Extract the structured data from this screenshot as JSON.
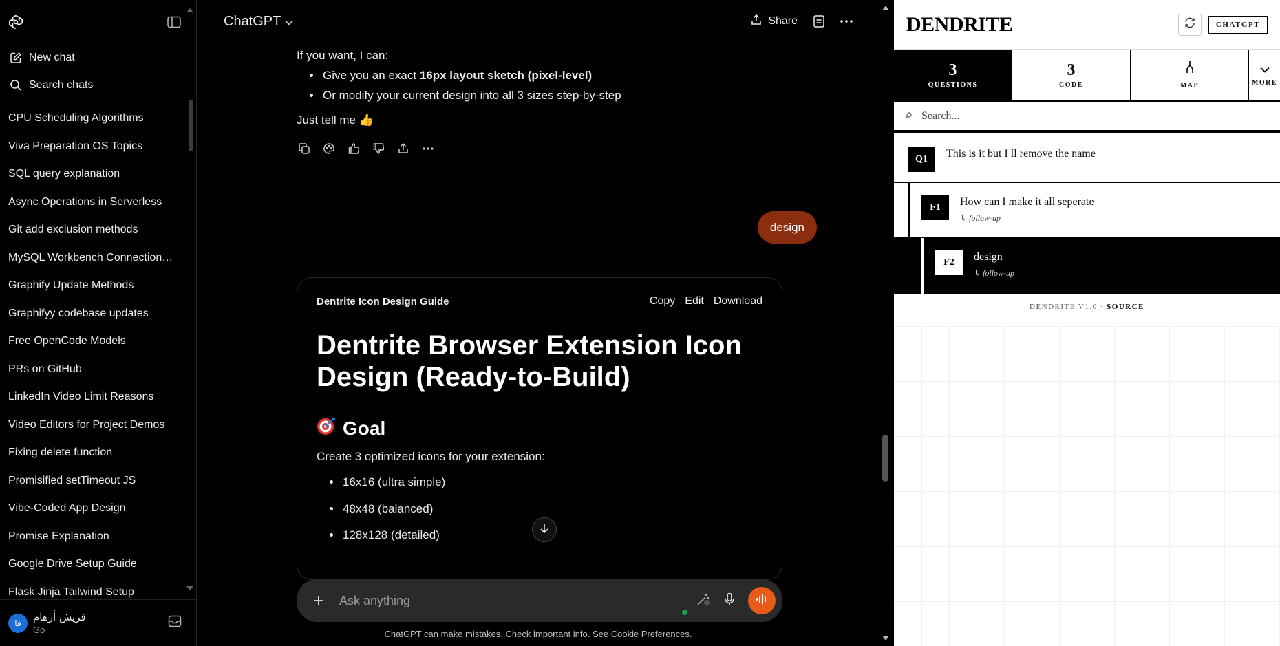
{
  "sidebar": {
    "new_chat": "New chat",
    "search_chats": "Search chats",
    "chats": [
      "CPU Scheduling Algorithms",
      "Viva Preparation OS Topics",
      "SQL query explanation",
      "Async Operations in Serverless",
      "Git add exclusion methods",
      "MySQL Workbench Connection…",
      "Graphify Update Methods",
      "Graphifyy codebase updates",
      "Free OpenCode Models",
      "PRs on GitHub",
      "LinkedIn Video Limit Reasons",
      "Video Editors for Project Demos",
      "Fixing delete function",
      "Promisified setTimeout JS",
      "Vibe-Coded App Design",
      "Promise Explanation",
      "Google Drive Setup Guide",
      "Flask Jinja Tailwind Setup"
    ],
    "user": {
      "initials": "قا",
      "name": "قريش أرهام",
      "plan": "Go"
    }
  },
  "header": {
    "model": "ChatGPT",
    "share": "Share"
  },
  "conversation": {
    "intro": "If you want, I can:",
    "bullets": [
      {
        "pre": "Give you an exact ",
        "bold": "16px layout sketch (pixel-level)",
        "post": ""
      },
      {
        "pre": "Or modify your current design into all 3 sizes step-by-step",
        "bold": "",
        "post": ""
      }
    ],
    "closing": "Just tell me 👍",
    "user_message": "design"
  },
  "canvas": {
    "title": "Dentrite Icon Design Guide",
    "tools": [
      "Copy",
      "Edit",
      "Download"
    ],
    "h1": "Dentrite Browser Extension Icon Design (Ready-to-Build)",
    "h2": "Goal",
    "paragraph": "Create 3 optimized icons for your extension:",
    "list": [
      "16x16 (ultra simple)",
      "48x48 (balanced)",
      "128x128 (detailed)"
    ]
  },
  "composer": {
    "placeholder": "Ask anything",
    "disclaimer": "ChatGPT can make mistakes. Check important info. See ",
    "disclaimer_link": "Cookie Preferences",
    "disclaimer_end": "."
  },
  "dendrite": {
    "logo": "DENDRITE",
    "chatgpt_button": "CHATGPT",
    "tabs": [
      {
        "num": "3",
        "label": "QUESTIONS",
        "active": true
      },
      {
        "num": "3",
        "label": "CODE",
        "active": false
      },
      {
        "num": "",
        "label": "MAP",
        "active": false
      }
    ],
    "more_label": "MORE",
    "search_placeholder": "Search...",
    "items": [
      {
        "badge": "Q1",
        "title": "This is it but I ll remove the name",
        "sub": ""
      },
      {
        "badge": "F1",
        "title": "How can I make it all seperate",
        "sub": "↳ follow-up"
      },
      {
        "badge": "F2",
        "title": "design",
        "sub": "↳ follow-up"
      }
    ],
    "footer_text": "DENDRITE V1.0 ·",
    "footer_link": "SOURCE"
  },
  "colors": {
    "accent": "#e95b1a",
    "user_bubble": "#8a2e0f",
    "avatar": "#1d6fd6",
    "online": "#17a34a"
  }
}
